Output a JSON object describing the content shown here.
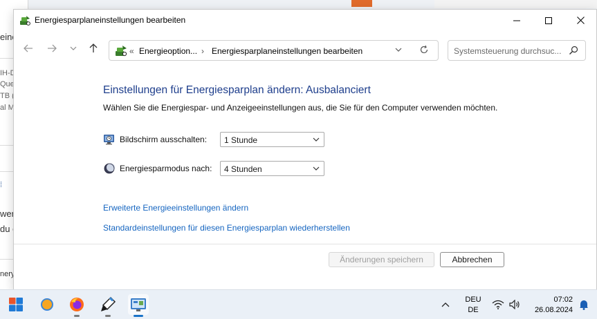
{
  "background_window": {
    "lines": [
      "eine",
      "IH-D",
      "Que",
      "TB (I",
      "al M",
      "wer",
      "du c",
      "nery"
    ]
  },
  "window": {
    "title": "Energiesparplaneinstellungen bearbeiten"
  },
  "navigation": {
    "breadcrumb_prefix": "«",
    "breadcrumbs": [
      "Energieoption...",
      "Energiesparplaneinstellungen bearbeiten"
    ],
    "separator": "›",
    "search_placeholder": "Systemsteuerung durchsuc..."
  },
  "content": {
    "heading": "Einstellungen für Energiesparplan ändern: Ausbalanciert",
    "subheading": "Wählen Sie die Energiespar- und Anzeigeeinstellungen aus, die Sie für den Computer verwenden möchten.",
    "settings": [
      {
        "label": "Bildschirm ausschalten:",
        "value": "1 Stunde",
        "icon": "monitor-clock-icon"
      },
      {
        "label": "Energiesparmodus nach:",
        "value": "4 Stunden",
        "icon": "moon-icon"
      }
    ],
    "links": [
      "Erweiterte Energieeinstellungen ändern",
      "Standardeinstellungen für diesen Energiesparplan wiederherstellen"
    ]
  },
  "buttons": {
    "save": "Änderungen speichern",
    "cancel": "Abbrechen"
  },
  "taskbar": {
    "apps": [
      "start",
      "weather",
      "firefox",
      "pen-tool",
      "control-panel"
    ],
    "language_top": "DEU",
    "language_bottom": "DE",
    "time": "07:02",
    "date": "26.08.2024"
  },
  "colors": {
    "heading": "#1e3e8c",
    "link": "#1565c0",
    "accent": "#1a73c8"
  }
}
